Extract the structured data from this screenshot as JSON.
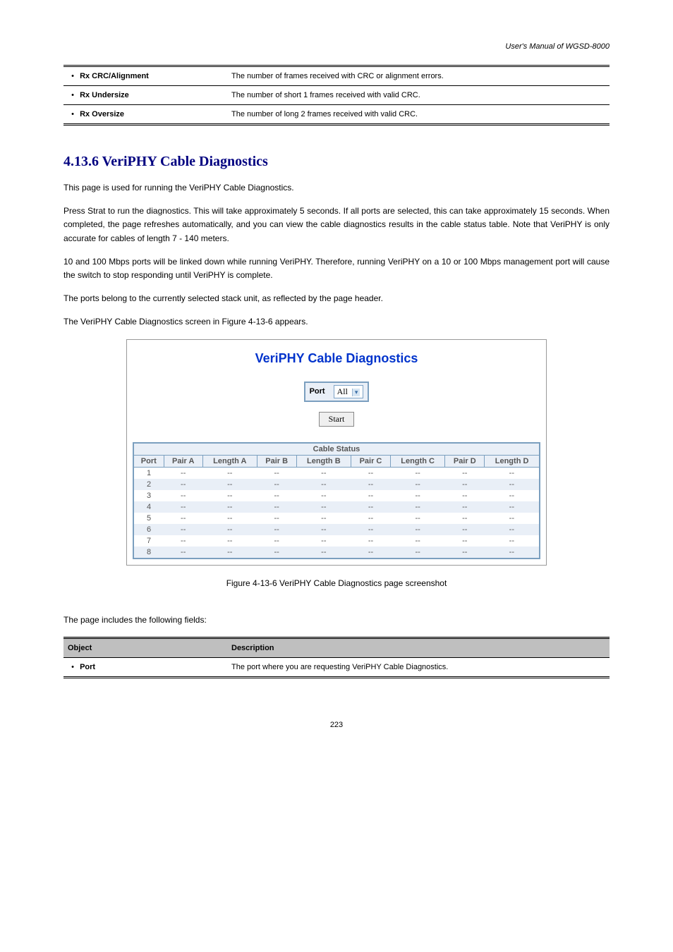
{
  "header": "User's Manual of WGSD-8000",
  "table1": {
    "row1": {
      "label": "Rx CRC/Alignment",
      "desc": "The number of frames received with CRC or alignment errors."
    },
    "row2": {
      "label": "Rx Undersize",
      "desc": "The number of short 1 frames received with valid CRC."
    },
    "row3": {
      "label": "Rx Oversize",
      "desc": "The number of long 2 frames received with valid CRC."
    }
  },
  "section": {
    "title": "4.13.6 VeriPHY Cable Diagnostics",
    "p1": "This page is used for running the VeriPHY Cable Diagnostics.",
    "p2": "Press Strat to run the diagnostics. This will take approximately 5 seconds. If all ports are selected, this can take approximately 15 seconds. When completed, the page refreshes automatically, and you can view the cable diagnostics results in the cable status table. Note that VeriPHY is only accurate for cables of length 7 - 140 meters.",
    "p3": "10 and 100 Mbps ports will be linked down while running VeriPHY. Therefore, running VeriPHY on a 10 or 100 Mbps management port will cause the switch to stop responding until VeriPHY is complete.",
    "p4": "The ports belong to the currently selected stack unit, as reflected by the page header.",
    "p5": "The VeriPHY Cable Diagnostics screen in Figure 4-13-6 appears."
  },
  "shot": {
    "title": "VeriPHY Cable Diagnostics",
    "port_label": "Port",
    "port_value": "All",
    "start_label": "Start",
    "status_label": "Cable Status",
    "cols": [
      "Port",
      "Pair A",
      "Length A",
      "Pair B",
      "Length B",
      "Pair C",
      "Length C",
      "Pair D",
      "Length D"
    ],
    "rows": [
      {
        "port": "1",
        "vals": [
          "--",
          "--",
          "--",
          "--",
          "--",
          "--",
          "--",
          "--"
        ]
      },
      {
        "port": "2",
        "vals": [
          "--",
          "--",
          "--",
          "--",
          "--",
          "--",
          "--",
          "--"
        ]
      },
      {
        "port": "3",
        "vals": [
          "--",
          "--",
          "--",
          "--",
          "--",
          "--",
          "--",
          "--"
        ]
      },
      {
        "port": "4",
        "vals": [
          "--",
          "--",
          "--",
          "--",
          "--",
          "--",
          "--",
          "--"
        ]
      },
      {
        "port": "5",
        "vals": [
          "--",
          "--",
          "--",
          "--",
          "--",
          "--",
          "--",
          "--"
        ]
      },
      {
        "port": "6",
        "vals": [
          "--",
          "--",
          "--",
          "--",
          "--",
          "--",
          "--",
          "--"
        ]
      },
      {
        "port": "7",
        "vals": [
          "--",
          "--",
          "--",
          "--",
          "--",
          "--",
          "--",
          "--"
        ]
      },
      {
        "port": "8",
        "vals": [
          "--",
          "--",
          "--",
          "--",
          "--",
          "--",
          "--",
          "--"
        ]
      }
    ]
  },
  "fig_caption": "Figure 4-13-6 VeriPHY Cable Diagnostics page screenshot",
  "lead_in": "The page includes the following fields:",
  "table2": {
    "h1": "Object",
    "h2": "Description",
    "row1": {
      "label": "Port",
      "desc": "The port where you are requesting VeriPHY Cable Diagnostics."
    }
  },
  "page_number": "223"
}
